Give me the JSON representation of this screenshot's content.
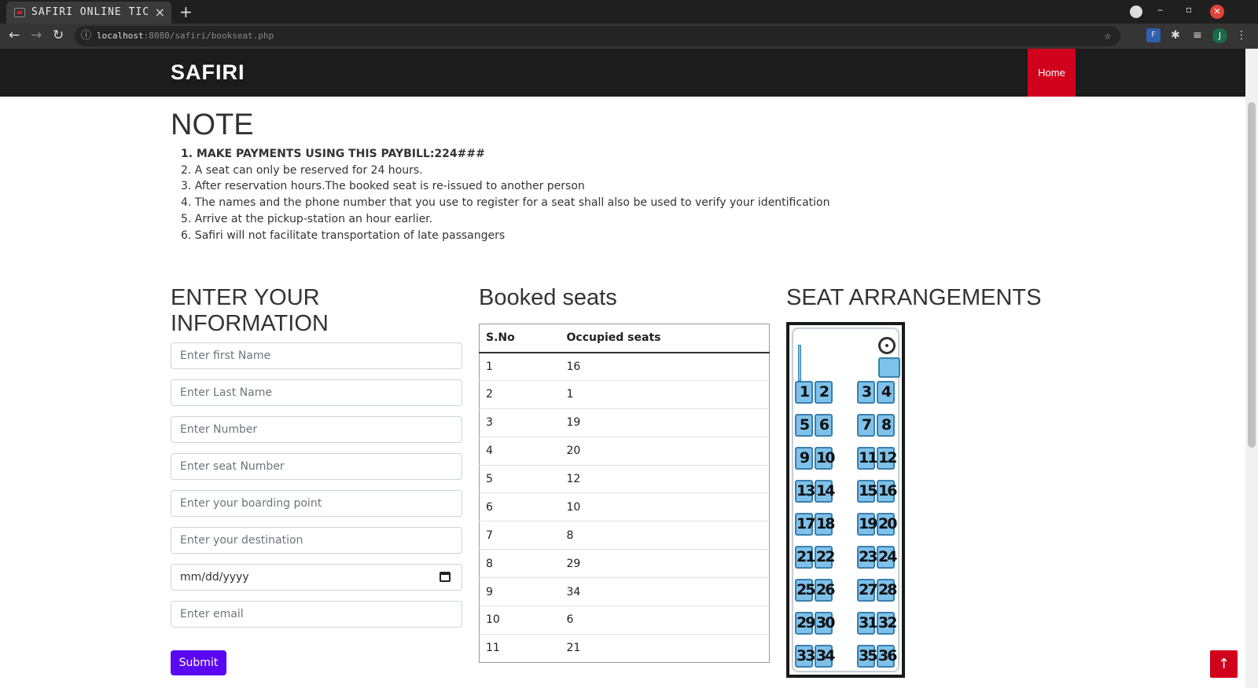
{
  "browser": {
    "tab_title": "SAFIRI ONLINE TIC",
    "tab_close": "×",
    "new_tab": "+",
    "url_host": "localhost",
    "url_rest": ":8080/safiri/bookseat.php",
    "avatar_letter": "J",
    "window_controls": [
      "–",
      "▫",
      "✕"
    ]
  },
  "navbar": {
    "brand": "SAFIRI",
    "home": "Home"
  },
  "note": {
    "title": "NOTE",
    "items": [
      "1. MAKE PAYMENTS USING THIS PAYBILL:224###",
      "2. A seat can only be reserved for 24 hours.",
      "3. After reservation hours.The booked seat is re-issued to another person",
      "4. The names and the phone number that you use to register for a seat shall also be used to verify your identification",
      "5. Arrive at the pickup-station an hour earlier.",
      "6. Safiri will not facilitate transportation of late passangers"
    ]
  },
  "form": {
    "title_line1": "ENTER YOUR",
    "title_line2": "INFORMATION",
    "first_name_placeholder": "Enter first Name",
    "last_name_placeholder": "Enter Last Name",
    "number_placeholder": "Enter Number",
    "seat_placeholder": "Enter seat Number",
    "boarding_placeholder": "Enter your boarding point",
    "destination_placeholder": "Enter your destination",
    "date_placeholder": "mm/dd/yyyy",
    "email_placeholder": "Enter email",
    "submit_label": "Submit"
  },
  "booked": {
    "title": "Booked seats",
    "headers": [
      "S.No",
      "Occupied seats"
    ],
    "rows": [
      [
        "1",
        "16"
      ],
      [
        "2",
        "1"
      ],
      [
        "3",
        "19"
      ],
      [
        "4",
        "20"
      ],
      [
        "5",
        "12"
      ],
      [
        "6",
        "10"
      ],
      [
        "7",
        "8"
      ],
      [
        "8",
        "29"
      ],
      [
        "9",
        "34"
      ],
      [
        "10",
        "6"
      ],
      [
        "11",
        "21"
      ]
    ]
  },
  "seats": {
    "title": "SEAT ARRANGEMENTS",
    "numbers": [
      1,
      2,
      3,
      4,
      5,
      6,
      7,
      8,
      9,
      10,
      11,
      12,
      13,
      14,
      15,
      16,
      17,
      18,
      19,
      20,
      21,
      22,
      23,
      24,
      25,
      26,
      27,
      28,
      29,
      30,
      31,
      32,
      33,
      34,
      35,
      36
    ]
  },
  "colors": {
    "navbar": "#1c1c1c",
    "accent_red": "#d1001c",
    "submit_purple": "#5a08f4",
    "seat_blue": "#7ec1ea"
  },
  "icons": {
    "back": "arrow-left-icon",
    "forward": "arrow-right-icon",
    "reload": "reload-icon",
    "scroll_top": "arrow-up-icon"
  }
}
